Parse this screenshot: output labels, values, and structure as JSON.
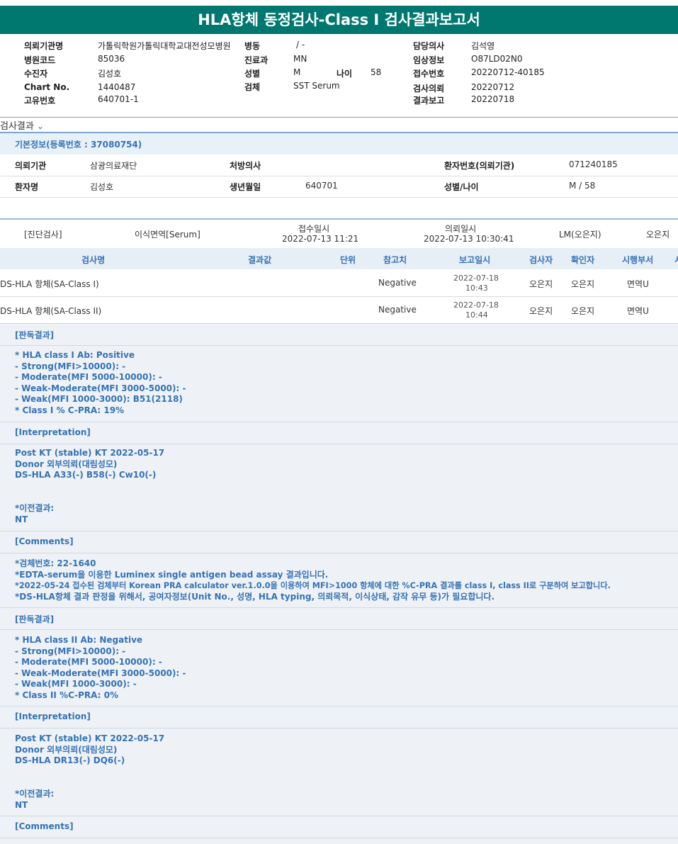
{
  "report": {
    "title": "HLA항체 동정검사-Class I 검사결과보고서"
  },
  "header": {
    "col1": [
      {
        "label": "의뢰기관명",
        "value": "가톨릭학원가톨릭대학교대전성모병원"
      },
      {
        "label": "병원코드",
        "value": "85036"
      },
      {
        "label": "수진자",
        "value": "김성호"
      },
      {
        "label": "Chart No.",
        "value": "1440487"
      },
      {
        "label": "고유번호",
        "value": "640701-1"
      }
    ],
    "col2": [
      {
        "label": "병동",
        "value": "/ -"
      },
      {
        "label": "진료과",
        "value": "MN"
      },
      {
        "label": "성별",
        "value": "M"
      },
      {
        "label": "검체",
        "value": "SST Serum"
      }
    ],
    "age": {
      "label": "나이",
      "value": "58"
    },
    "col3": [
      {
        "label": "담당의사",
        "value": "김석영"
      },
      {
        "label": "임상정보",
        "value": "O87LD02N0"
      },
      {
        "label": "접수번호",
        "value": "20220712-40185"
      },
      {
        "label": "검사의뢰",
        "value": "20220712"
      },
      {
        "label": "결과보고",
        "value": "20220718"
      }
    ]
  },
  "result_section": {
    "toggle_label": "검사결과",
    "toggle_icon": "chevron-down-icon"
  },
  "basic_info": {
    "title": "기본정보(등록번호 : 37080754)",
    "row1": {
      "l1": "의뢰기관",
      "v1": "삼광의료재단",
      "l2": "처방의사",
      "v2": "",
      "l3": "환자번호(의뢰기관)",
      "v3": "071240185"
    },
    "row2": {
      "l1": "환자명",
      "v1": "김성호",
      "l2": "생년월일",
      "v2": "640701",
      "l3": "성별/나이",
      "v3": "M / 58"
    }
  },
  "order": {
    "category": "[진단검사]",
    "test_group": "이식면역[Serum]",
    "received_label": "접수일시",
    "received_value": "2022-07-13  11:21",
    "requested_label": "의뢰일시",
    "requested_value": "2022-07-13  10:30:41",
    "lm": "LM(오은지)",
    "person": "오은지"
  },
  "test_table": {
    "headers": {
      "name": "검사명",
      "result": "결과값",
      "unit": "단위",
      "reference": "참고치",
      "reported": "보고일시",
      "tester": "검사자",
      "confirmer": "확인자",
      "dept": "시행부서",
      "extra": "시"
    },
    "rows": [
      {
        "name": "DS-HLA 항체(SA-Class I)",
        "result": "",
        "unit": "",
        "reference": "Negative",
        "date": "2022-07-18",
        "time": "10:43",
        "tester": "오은지",
        "confirmer": "오은지",
        "dept": "면역U"
      },
      {
        "name": "DS-HLA 항체(SA-Class II)",
        "result": "",
        "unit": "",
        "reference": "Negative",
        "date": "2022-07-18",
        "time": "10:44",
        "tester": "오은지",
        "confirmer": "오은지",
        "dept": "면역U"
      }
    ]
  },
  "remarks": {
    "h1": "[판독결과]",
    "class1_lines": [
      "* HLA class I Ab: Positive",
      "- Strong(MFI>10000): -",
      "- Moderate(MFI 5000-10000): -",
      "- Weak-Moderate(MFI 3000-5000): -",
      "- Weak(MFI 1000-3000): B51(2118)",
      "* Class I % C-PRA: 19%"
    ],
    "h2": "[Interpretation]",
    "interp1_lines": [
      "Post KT (stable) KT 2022-05-17",
      "Donor 외부의뢰(대림성모)",
      "DS-HLA A33(-) B58(-) Cw10(-)"
    ],
    "prev1_lines": [
      "*이전결과:",
      "NT"
    ],
    "h3": "[Comments]",
    "comment_lines": [
      "*검체번호: 22-1640",
      "*EDTA-serum을 이용한 Luminex single antigen bead assay 결과입니다.",
      "*2022-05-24 접수된 검체부터 Korean PRA calculator ver.1.0.0을 이용하여 MFI>1000 항체에 대한 %C-PRA 결과를 class I, class II로 구분하여 보고합니다.",
      "*DS-HLA항체 결과 판정을 위해서, 공여자정보(Unit No., 성명, HLA typing, 의뢰목적, 이식상태, 감작 유무 등)가 필요합니다."
    ],
    "h4": "[판독결과]",
    "class2_lines": [
      "* HLA class II Ab: Negative",
      "- Strong(MFI>10000): -",
      "- Moderate(MFI 5000-10000): -",
      "- Weak-Moderate(MFI 3000-5000): -",
      "- Weak(MFI 1000-3000): -",
      "* Class II %C-PRA: 0%"
    ],
    "h5": "[Interpretation]",
    "interp2_lines": [
      "Post KT (stable) KT 2022-05-17",
      "Donor 외부의뢰(대림성모)",
      "DS-HLA DR13(-) DQ6(-)"
    ],
    "prev2_lines": [
      "*이전결과:",
      "NT"
    ],
    "h6": "[Comments]"
  }
}
